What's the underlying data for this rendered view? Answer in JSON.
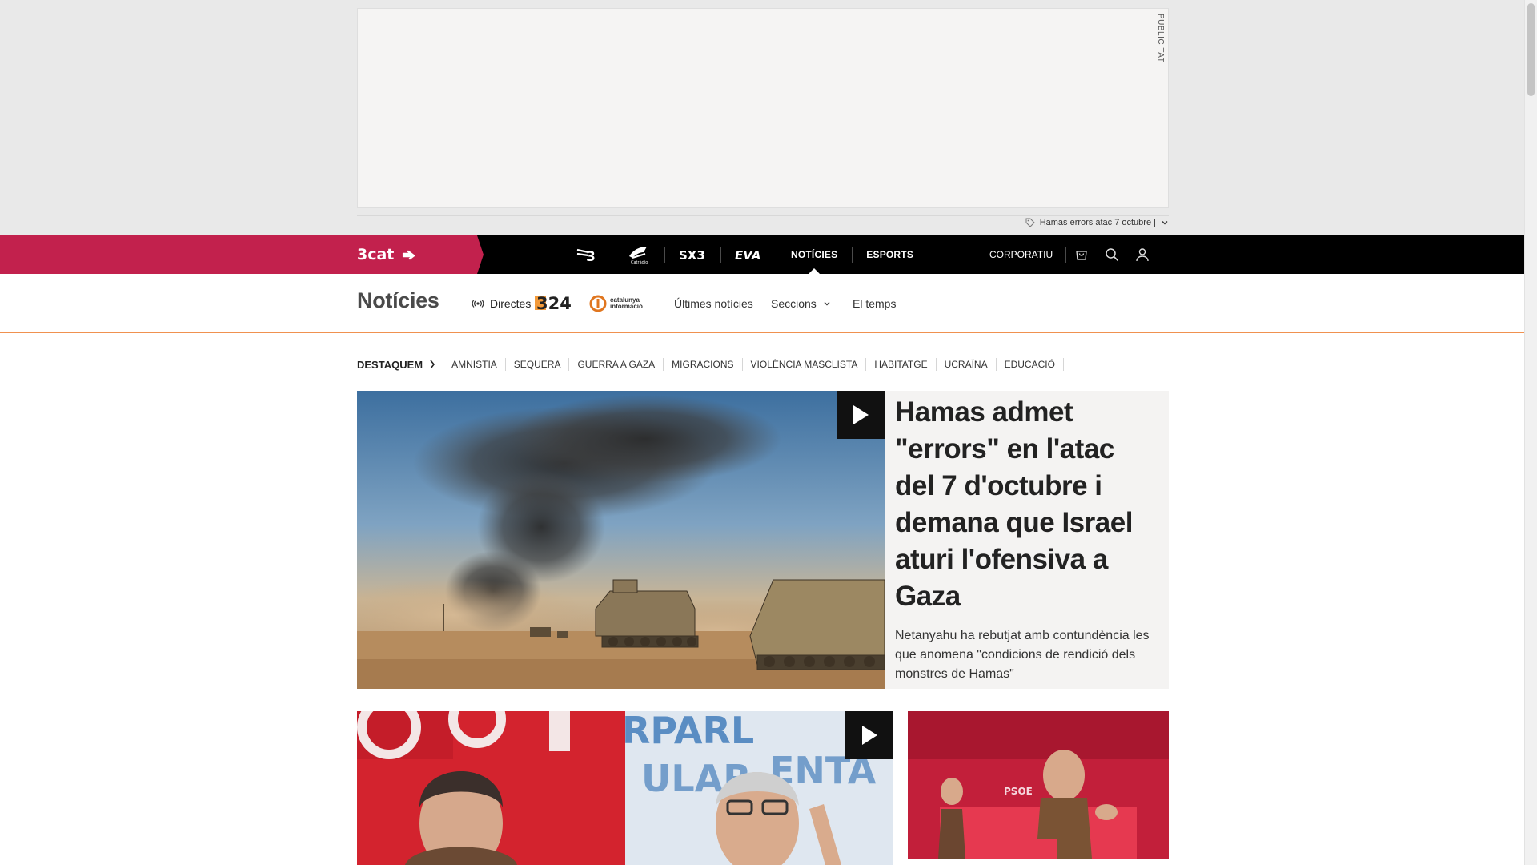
{
  "ad": {
    "label": "PUBLICITAT"
  },
  "trending": {
    "text": "Hamas errors atac 7 octubre |"
  },
  "network": {
    "brand": "3cat",
    "items": [
      {
        "id": "tv3",
        "label": "TV3",
        "icon": "tv3-logo-icon"
      },
      {
        "id": "catradio",
        "label": "Catràdio",
        "icon": "catradio-logo-icon"
      },
      {
        "id": "sx3",
        "label": "SX3",
        "icon": "sx3-logo-icon"
      },
      {
        "id": "eva",
        "label": "EVA",
        "icon": "eva-logo-icon"
      },
      {
        "id": "noticies",
        "label": "NOTÍCIES",
        "active": true
      },
      {
        "id": "esports",
        "label": "ESPORTS"
      }
    ],
    "corporate": "CORPORATIU",
    "icons": [
      "shop-icon",
      "search-icon",
      "user-icon"
    ]
  },
  "section": {
    "title": "Notícies",
    "directes": "Directes",
    "channel_324": "324",
    "channel_ci": [
      "catalunya",
      "informació"
    ],
    "links": {
      "ultimes": "Últimes notícies",
      "seccions": "Seccions",
      "temps": "El temps"
    }
  },
  "destaquem": {
    "label": "DESTAQUEM",
    "items": [
      "AMNISTIA",
      "SEQUERA",
      "GUERRA A GAZA",
      "MIGRACIONS",
      "VIOLÈNCIA MASCLISTA",
      "HABITATGE",
      "UCRAÏNA",
      "EDUCACIÓ"
    ]
  },
  "main_story": {
    "headline": "Hamas admet \"errors\" en l'atac del 7 d'octubre i demana que Israel aturi l'ofensiva a Gaza",
    "lead": "Netanyahu ha rebutjat amb contundència les que anomena \"condicions de rendició dels monstres de Hamas\""
  },
  "colors": {
    "brand_red": "#c2214d",
    "accent_orange": "#f0914f",
    "nav_black": "#000000",
    "card_bg": "#f4f3f2"
  }
}
